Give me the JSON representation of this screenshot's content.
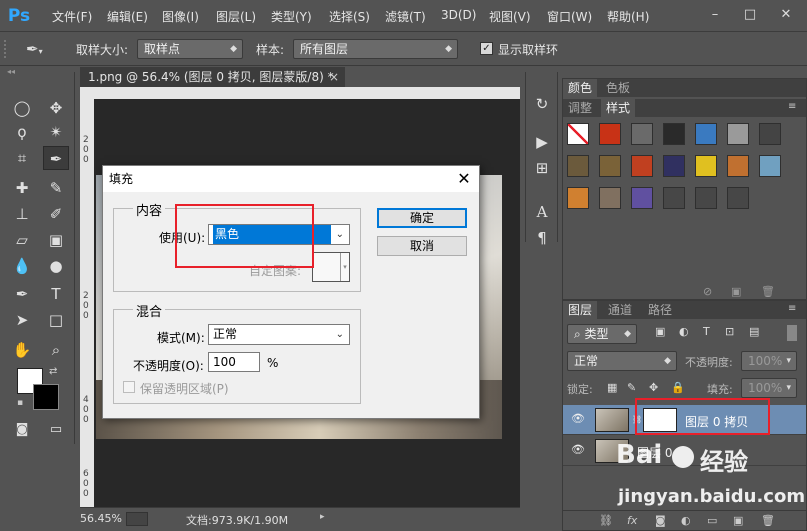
{
  "app": {
    "logo": "Ps",
    "menu": [
      "文件(F)",
      "编辑(E)",
      "图像(I)",
      "图层(L)",
      "类型(Y)",
      "选择(S)",
      "滤镜(T)",
      "3D(D)",
      "视图(V)",
      "窗口(W)",
      "帮助(H)"
    ],
    "window_controls": [
      "–",
      "□",
      "✕"
    ]
  },
  "options_bar": {
    "sample_size_label": "取样大小:",
    "sample_size_value": "取样点",
    "sample_label": "样本:",
    "sample_value": "所有图层",
    "show_ring_label": "显示取样环",
    "show_ring_checked": true
  },
  "document": {
    "tab_title": "1.png @ 56.4% (图层 0 拷贝, 图层蒙版/8) *",
    "tab_close": "×",
    "ruler_left_marks": [
      "2",
      "0",
      "0",
      "2",
      "0",
      "0",
      "4",
      "0",
      "0",
      "6",
      "0",
      "0"
    ],
    "zoom": "56.45%",
    "doc_size": "文档:973.9K/1.90M"
  },
  "style_panel": {
    "tabs_row1": [
      "颜色",
      "色板"
    ],
    "tabs_row2": [
      "调整",
      "样式"
    ],
    "swatch_colors": [
      [
        "#ffffff",
        "#c83216",
        "#6a6a6a",
        "#2a2a2a",
        "#3a7ac0",
        "#9a9a9a",
        "#444444"
      ],
      [
        "#6b5a3c",
        "#7a6238",
        "#c04020",
        "#303060",
        "#e0c020",
        "#c07030",
        "#70a0c0"
      ],
      [
        "#d08030",
        "#807060",
        "#6050a0",
        "#474747",
        "#474747",
        "#474747",
        ""
      ]
    ]
  },
  "layers_panel": {
    "tabs": [
      "图层",
      "通道",
      "路径"
    ],
    "filter_label": "类型",
    "blend_mode": "正常",
    "opacity_label": "不透明度:",
    "opacity_value": "100%",
    "lock_label": "锁定:",
    "fill_label": "填充:",
    "fill_value": "100%",
    "layers": [
      {
        "name": "图层 0 拷贝",
        "selected": true
      },
      {
        "name": "图层 0",
        "selected": false
      }
    ]
  },
  "dialog": {
    "title": "填充",
    "close": "✕",
    "content_group": "内容",
    "use_label": "使用(U):",
    "use_value": "黑色",
    "custom_pattern_label": "自定图案:",
    "blend_group": "混合",
    "mode_label": "模式(M):",
    "mode_value": "正常",
    "opacity_label": "不透明度(O):",
    "opacity_value": "100",
    "opacity_unit": "%",
    "preserve_label": "保留透明区域(P)",
    "ok_label": "确定",
    "cancel_label": "取消",
    "highlight_color": "#e8202a",
    "accent_color": "#0078d7"
  },
  "watermark": {
    "brand": "Bai",
    "brand2": "经验",
    "url": "jingyan.baidu.com"
  }
}
